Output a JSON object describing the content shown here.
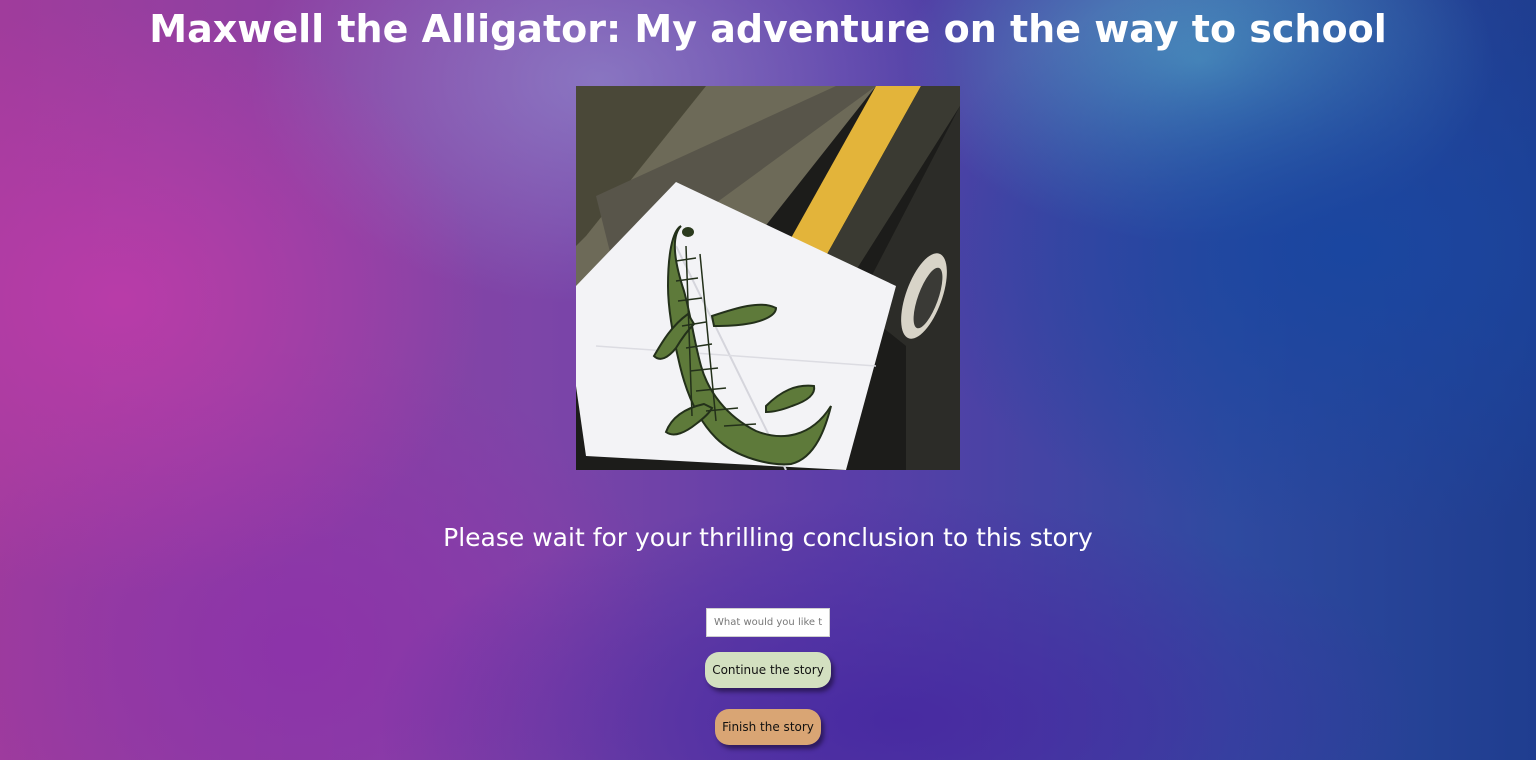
{
  "page": {
    "title": "Maxwell the Alligator: My adventure on the way to school"
  },
  "story_image": {
    "icon": "alligator-drawing-image"
  },
  "status": {
    "message": "Please wait for your thrilling conclusion to this story"
  },
  "prompt": {
    "value": "",
    "placeholder": "What would you like to"
  },
  "actions": {
    "continue_label": "Continue the story",
    "finish_label": "Finish the story"
  },
  "colors": {
    "continue_button": "#d3e0c0",
    "finish_button": "#d9a574",
    "text": "#ffffff"
  }
}
